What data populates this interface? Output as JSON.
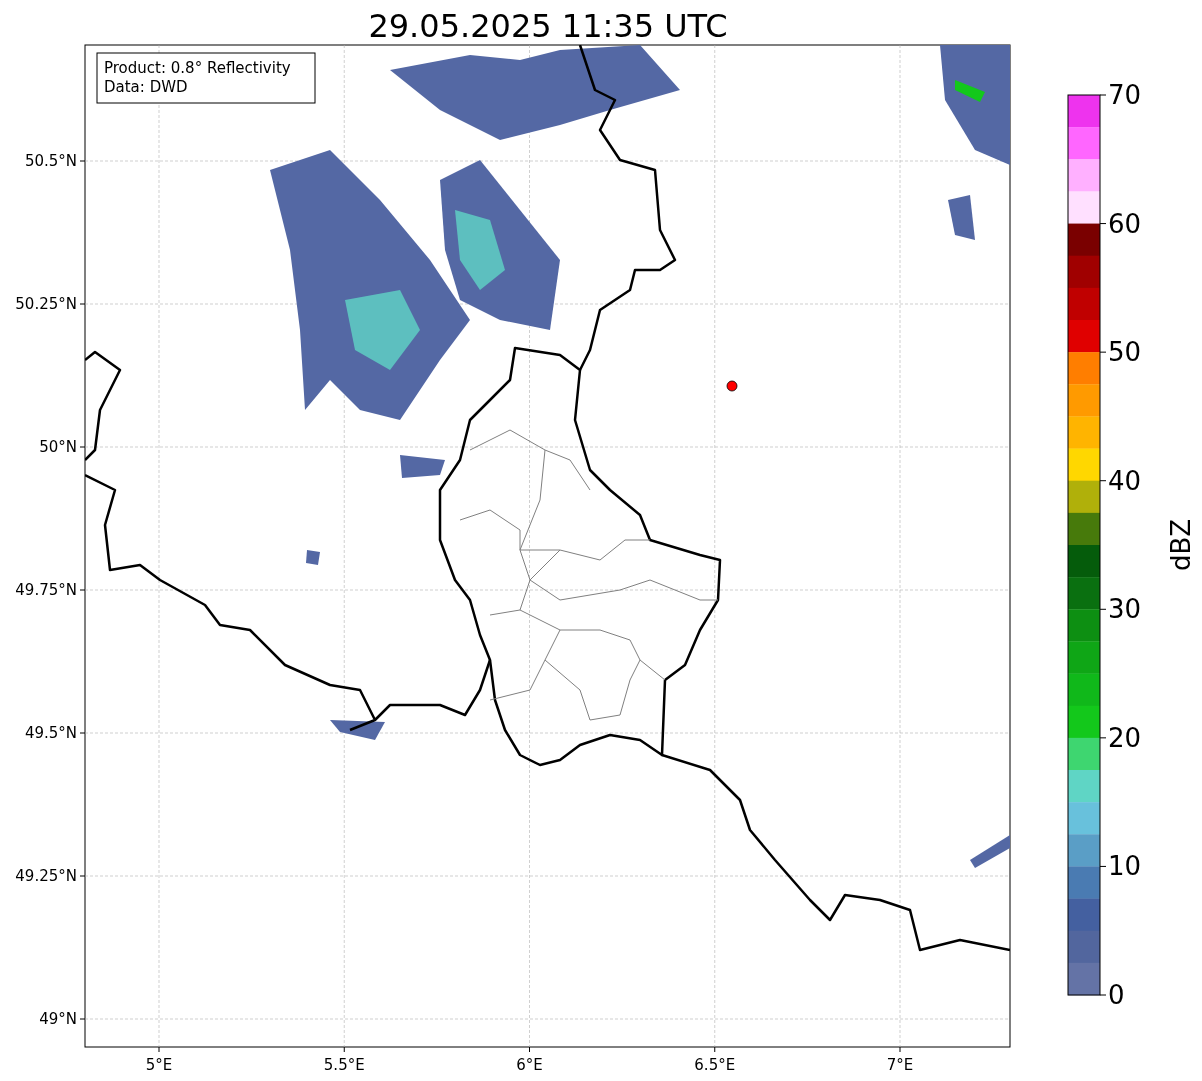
{
  "title": "29.05.2025 11:35 UTC",
  "info_box": {
    "lines": [
      "Product: 0.8° Reflectivity",
      "Data: DWD"
    ]
  },
  "map": {
    "x_ticks": [
      "5°E",
      "5.5°E",
      "6°E",
      "6.5°E",
      "7°E"
    ],
    "y_ticks": [
      "50.5°N",
      "50.25°N",
      "50°N",
      "49.75°N",
      "49.5°N",
      "49.25°N",
      "49°N"
    ]
  },
  "colorbar": {
    "label": "dBZ",
    "ticks": [
      "70",
      "60",
      "50",
      "40",
      "30",
      "20",
      "10",
      "0"
    ],
    "segments": [
      {
        "color": "#ee33ee"
      },
      {
        "color": "#ff66ff"
      },
      {
        "color": "#ffb0ff"
      },
      {
        "color": "#ffe0ff"
      },
      {
        "color": "#7a0000"
      },
      {
        "color": "#a00000"
      },
      {
        "color": "#c00000"
      },
      {
        "color": "#e00000"
      },
      {
        "color": "#ff7e00"
      },
      {
        "color": "#ff9a00"
      },
      {
        "color": "#ffb400"
      },
      {
        "color": "#ffd700"
      },
      {
        "color": "#b0b00a"
      },
      {
        "color": "#477a0b"
      },
      {
        "color": "#055c0b"
      },
      {
        "color": "#0a7010"
      },
      {
        "color": "#0d8f12"
      },
      {
        "color": "#0fa616"
      },
      {
        "color": "#10b81a"
      },
      {
        "color": "#13c81b"
      },
      {
        "color": "#3ed670"
      },
      {
        "color": "#5fd5c5"
      },
      {
        "color": "#68c1dc"
      },
      {
        "color": "#5a9ec6"
      },
      {
        "color": "#4a7bb2"
      },
      {
        "color": "#4460a0"
      },
      {
        "color": "#52669e"
      },
      {
        "color": "#6473a6"
      }
    ]
  }
}
